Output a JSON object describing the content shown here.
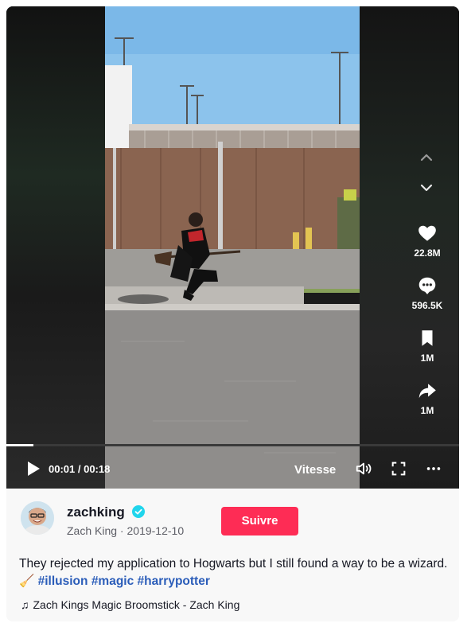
{
  "video": {
    "current_time": "00:01",
    "duration": "00:18",
    "time_separator": " / ",
    "progress": 0.06,
    "speed_label": "Vitesse"
  },
  "actions": {
    "likes": "22.8M",
    "comments": "596.5K",
    "saves": "1M",
    "shares": "1M"
  },
  "author": {
    "username": "zachking",
    "display_name": "Zach King",
    "date": "2019-12-10",
    "separator": " · ",
    "follow_label": "Suivre"
  },
  "description": {
    "text": "They rejected my application to Hogwarts but I still found a way to be a wizard. 🧹",
    "hashtags": [
      "#illusion",
      "#magic",
      "#harrypotter"
    ]
  },
  "music": {
    "title": "Zach Kings Magic Broomstick - Zach King"
  },
  "colors": {
    "follow_button": "#fe2c55",
    "hashtag": "#2b5db9",
    "verified": "#20d5ec"
  },
  "icons": [
    "chevron-up-icon",
    "chevron-down-icon",
    "heart-icon",
    "comment-icon",
    "bookmark-icon",
    "share-icon",
    "play-icon",
    "volume-icon",
    "fullscreen-icon",
    "more-icon",
    "verified-icon",
    "music-note-icon"
  ]
}
